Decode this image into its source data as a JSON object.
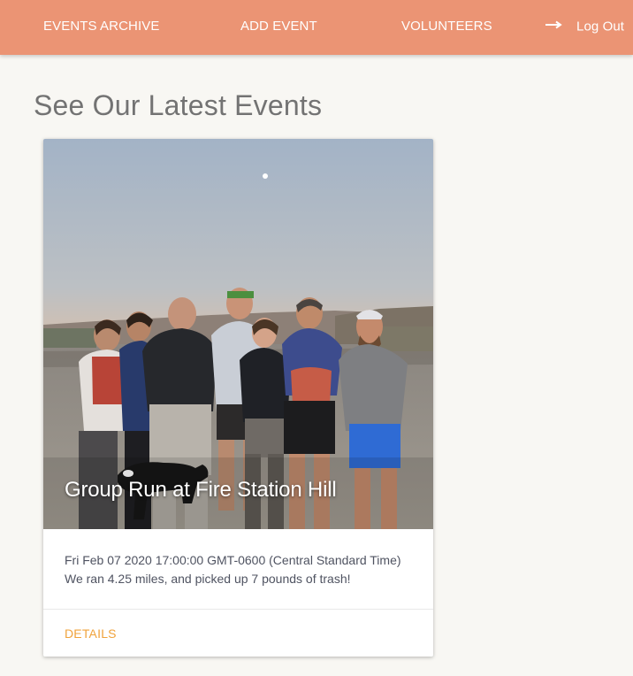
{
  "nav": {
    "events_archive": "EVENTS ARCHIVE",
    "add_event": "ADD EVENT",
    "volunteers": "VOLUNTEERS",
    "logout": "Log Out",
    "logout_icon": "arrow-right-icon"
  },
  "page": {
    "title": "See Our Latest Events"
  },
  "events": [
    {
      "title": "Group Run at Fire Station Hill",
      "date": "Fri Feb 07 2020 17:00:00 GMT-0600 (Central Standard Time)",
      "description": "We ran 4.25 miles, and picked up 7 pounds of trash!",
      "action_label": "DETAILS"
    }
  ],
  "colors": {
    "navbar": "#eb9474",
    "background": "#f8f7f3",
    "title": "#737373",
    "action": "#f0a33c"
  }
}
